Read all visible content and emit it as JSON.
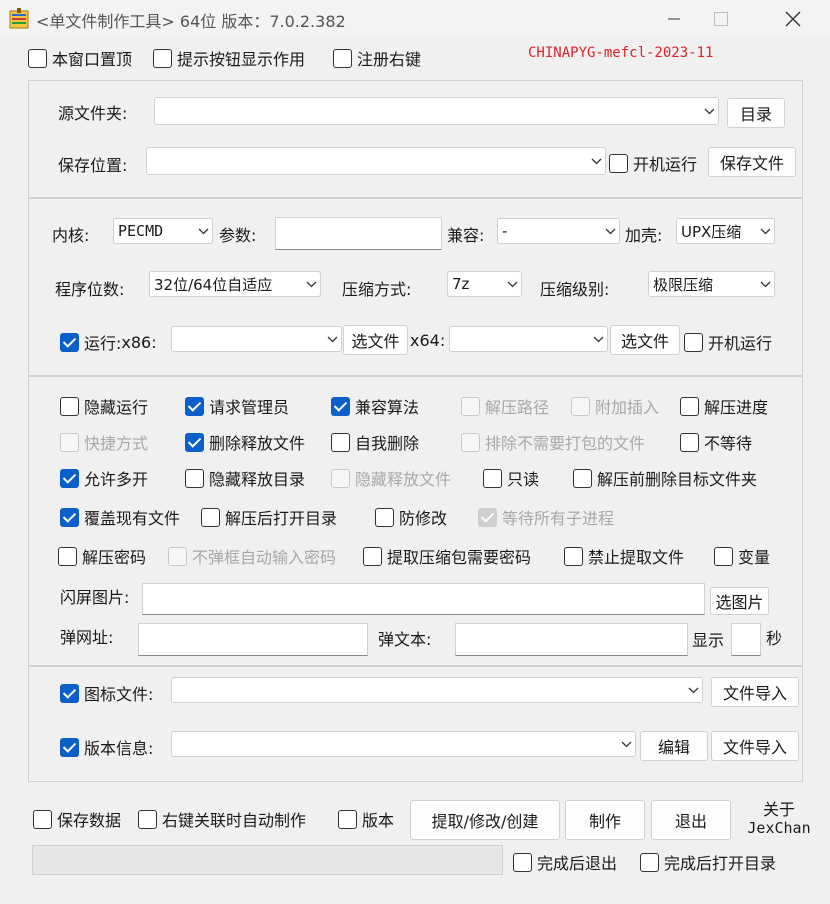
{
  "window": {
    "title": "<单文件制作工具> 64位 版本：7.0.2.382"
  },
  "top_options": {
    "always_on_top": "本窗口置顶",
    "show_button_tips": "提示按钮显示作用",
    "register_context_menu": "注册右键",
    "watermark": "CHINAPYG-mefcl-2023-11"
  },
  "paths": {
    "source_folder_label": "源文件夹:",
    "source_folder_value": "",
    "dir_button": "目录",
    "save_location_label": "保存位置:",
    "save_location_value": "",
    "autorun_label": "开机运行",
    "save_file_button": "保存文件"
  },
  "build": {
    "kernel_label": "内核:",
    "kernel_value": "PECMD",
    "params_label": "参数:",
    "params_value": "",
    "compat_label": "兼容:",
    "compat_value": "-",
    "packer_label": "加壳:",
    "packer_value": "UPX压缩",
    "bits_label": "程序位数:",
    "bits_value": "32位/64位自适应",
    "compress_method_label": "压缩方式:",
    "compress_method_value": "7z",
    "compress_level_label": "压缩级别:",
    "compress_level_value": "极限压缩",
    "run_label": "运行:",
    "x86_label": "x86:",
    "x86_value": "",
    "x64_label": "x64:",
    "x64_value": "",
    "pick_file": "选文件",
    "autorun_label": "开机运行"
  },
  "options": {
    "hide_run": "隐藏运行",
    "request_admin": "请求管理员",
    "compat_algo": "兼容算法",
    "extract_path": "解压路径",
    "append_insert": "附加插入",
    "extract_progress": "解压进度",
    "shortcut": "快捷方式",
    "delete_released": "删除释放文件",
    "self_delete": "自我删除",
    "exclude_unneeded": "排除不需要打包的文件",
    "no_wait": "不等待",
    "allow_multi": "允许多开",
    "hide_release_dir": "隐藏释放目录",
    "hide_release_file": "隐藏释放文件",
    "readonly": "只读",
    "delete_target_before": "解压前删除目标文件夹",
    "overwrite": "覆盖现有文件",
    "open_dir_after": "解压后打开目录",
    "anti_modify": "防修改",
    "wait_children": "等待所有子进程",
    "extract_password": "解压密码",
    "no_popup_password": "不弹框自动输入密码",
    "extract_needs_password": "提取压缩包需要密码",
    "forbid_extract": "禁止提取文件",
    "variables": "变量",
    "splash_label": "闪屏图片:",
    "splash_value": "",
    "pick_image": "选图片",
    "popup_url_label": "弹网址:",
    "popup_url_value": "",
    "popup_text_label": "弹文本:",
    "popup_text_value": "",
    "show_label": "显示",
    "show_value": "",
    "seconds_label": "秒"
  },
  "resources": {
    "icon_file_label": "图标文件:",
    "icon_file_value": "",
    "import_file": "文件导入",
    "version_info_label": "版本信息:",
    "version_info_value": "",
    "edit_button": "编辑"
  },
  "footer": {
    "save_data": "保存数据",
    "auto_build_context": "右键关联时自动制作",
    "version": "版本",
    "extract_modify_create": "提取/修改/创建",
    "make": "制作",
    "exit": "退出",
    "about_line1": "关于",
    "about_line2": "JexChan",
    "exit_when_done": "完成后退出",
    "open_dir_when_done": "完成后打开目录",
    "progress": 0
  },
  "colors": {
    "accent": "#0a5fc8",
    "watermark": "#e0202a",
    "background": "#f0f0f0"
  }
}
